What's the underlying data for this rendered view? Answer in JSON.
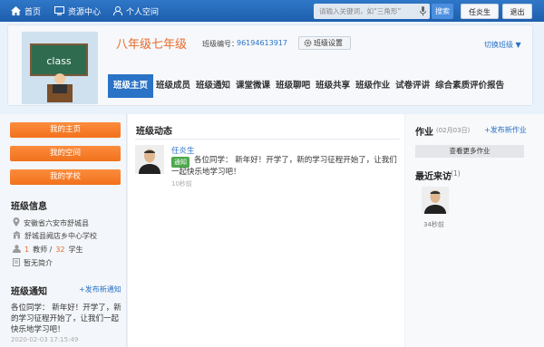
{
  "topbar": {
    "home_label": "首页",
    "resource_label": "资源中心",
    "personal_label": "个人空间",
    "search_placeholder": "请输入关键词，如“三角形”",
    "search_button": "搜索",
    "user_name": "任炎生",
    "logout_label": "退出"
  },
  "header": {
    "class_name": "八年级七年级",
    "class_number_label": "班级编号：",
    "class_number": "96194613917",
    "settings_label": "班级设置",
    "switch_label": "切换班级",
    "photo_text": "class"
  },
  "tabs": [
    {
      "label": "班级主页"
    },
    {
      "label": "班级成员"
    },
    {
      "label": "班级通知"
    },
    {
      "label": "课堂微课"
    },
    {
      "label": "班级聊吧"
    },
    {
      "label": "班级共享"
    },
    {
      "label": "班级作业"
    },
    {
      "label": "试卷评讲"
    },
    {
      "label": "综合素质评价报告"
    }
  ],
  "left": {
    "my_home": "我的主页",
    "my_space": "我的空间",
    "my_school": "我的学校",
    "info_title": "班级信息",
    "location": "安徽省六安市舒城县",
    "school": "舒城县阙店乡中心学校",
    "teacher_count": "1",
    "teacher_label": "教师 /",
    "student_count": "32",
    "student_label": "学生",
    "intro": "暂无简介",
    "notice_title": "班级通知",
    "publish_notice": "+发布新通知",
    "notice_text": "各位同学： 新年好！开学了，新的学习征程开始了，让我们一起快乐地学习吧！",
    "notice_time": "2020-02-03 17:15:49"
  },
  "middle": {
    "title": "班级动态",
    "author": "任炎生",
    "tag": "通知",
    "text": "各位同学： 新年好！开学了，新的学习征程开始了，让我们一起快乐地学习吧！",
    "time": "10秒前"
  },
  "right": {
    "homework_title": "作业",
    "homework_date": "(02月03日)",
    "publish_homework": "+发布新作业",
    "more_homework": "查看更多作业",
    "visitors_title": "最近来访",
    "visitors_count": "(1)",
    "visitor_time": "34秒前"
  },
  "colors": {
    "accent": "#2a73c6",
    "orange": "#f2711c",
    "class_name": "#e86a2b"
  }
}
